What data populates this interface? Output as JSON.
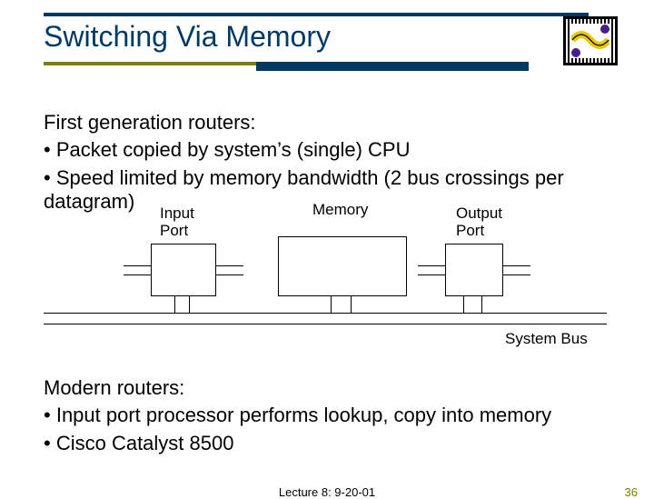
{
  "title": "Switching Via Memory",
  "section1": {
    "heading": "First generation routers:",
    "bullets": [
      "Packet copied by system’s (single) CPU",
      "Speed limited by memory bandwidth (2 bus crossings per datagram)"
    ]
  },
  "diagram": {
    "input_label": "Input\nPort",
    "memory_label": "Memory",
    "output_label": "Output\nPort",
    "bus_label": "System Bus"
  },
  "section2": {
    "heading": "Modern routers:",
    "bullets": [
      "Input port processor performs lookup, copy into memory",
      "Cisco Catalyst 8500"
    ]
  },
  "footer": {
    "center": "Lecture 8: 9-20-01",
    "page": "36"
  },
  "colors": {
    "accent_navy": "#003a63",
    "accent_olive": "#808000"
  }
}
